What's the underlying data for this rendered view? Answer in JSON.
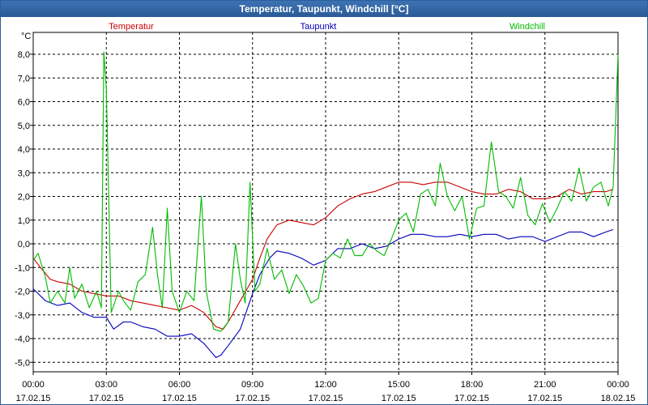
{
  "window": {
    "title": "Temperatur, Taupunkt, Windchill [°C]"
  },
  "colors": {
    "background": "#ffffff",
    "grid": "#000000",
    "temperatur": "#cc0000",
    "taupunkt": "#0000bb",
    "windchill": "#00bb00"
  },
  "chart_data": {
    "type": "line",
    "title": "Temperatur, Taupunkt, Windchill [°C]",
    "ylabel": "°C",
    "xlabel": "",
    "ylim": [
      -5.5,
      8.5
    ],
    "xlim": [
      0,
      24
    ],
    "grid": true,
    "legend_position": "top",
    "y_ticks": [
      8.0,
      7.0,
      6.0,
      5.0,
      4.0,
      3.0,
      2.0,
      1.0,
      0.0,
      -1.0,
      -2.0,
      -3.0,
      -4.0,
      -5.0
    ],
    "y_tick_labels": [
      "8,0",
      "7,0",
      "6,0",
      "5,0",
      "4,0",
      "3,0",
      "2,0",
      "1,0",
      "0,0",
      "-1,0",
      "-2,0",
      "-3,0",
      "-4,0",
      "-5,0"
    ],
    "x_ticks": [
      0,
      3,
      6,
      9,
      12,
      15,
      18,
      21,
      24
    ],
    "x_tick_labels": [
      {
        "time": "00:00",
        "date": "17.02.15"
      },
      {
        "time": "03:00",
        "date": "17.02.15"
      },
      {
        "time": "06:00",
        "date": "17.02.15"
      },
      {
        "time": "09:00",
        "date": "17.02.15"
      },
      {
        "time": "12:00",
        "date": "17.02.15"
      },
      {
        "time": "15:00",
        "date": "17.02.15"
      },
      {
        "time": "18:00",
        "date": "17.02.15"
      },
      {
        "time": "21:00",
        "date": "17.02.15"
      },
      {
        "time": "00:00",
        "date": "18.02.15"
      }
    ],
    "series": [
      {
        "name": "Temperatur",
        "color": "#cc0000",
        "points": [
          [
            0,
            -0.6
          ],
          [
            0.3,
            -1.0
          ],
          [
            0.7,
            -1.5
          ],
          [
            1.0,
            -1.6
          ],
          [
            1.5,
            -1.7
          ],
          [
            2.0,
            -2.0
          ],
          [
            2.5,
            -2.1
          ],
          [
            3.0,
            -2.2
          ],
          [
            3.5,
            -2.2
          ],
          [
            4.0,
            -2.4
          ],
          [
            4.5,
            -2.5
          ],
          [
            5.0,
            -2.6
          ],
          [
            5.5,
            -2.7
          ],
          [
            6.0,
            -2.8
          ],
          [
            6.5,
            -2.6
          ],
          [
            7.0,
            -2.9
          ],
          [
            7.5,
            -3.5
          ],
          [
            7.8,
            -3.6
          ],
          [
            8.0,
            -3.3
          ],
          [
            8.5,
            -2.4
          ],
          [
            9.0,
            -1.5
          ],
          [
            9.3,
            -0.6
          ],
          [
            9.6,
            0.2
          ],
          [
            10.0,
            0.8
          ],
          [
            10.5,
            1.0
          ],
          [
            11.0,
            0.9
          ],
          [
            11.5,
            0.8
          ],
          [
            12.0,
            1.1
          ],
          [
            12.5,
            1.6
          ],
          [
            13.0,
            1.9
          ],
          [
            13.5,
            2.1
          ],
          [
            14.0,
            2.2
          ],
          [
            14.5,
            2.4
          ],
          [
            15.0,
            2.6
          ],
          [
            15.5,
            2.6
          ],
          [
            16.0,
            2.5
          ],
          [
            16.5,
            2.6
          ],
          [
            17.0,
            2.6
          ],
          [
            17.5,
            2.4
          ],
          [
            18.0,
            2.2
          ],
          [
            18.5,
            2.1
          ],
          [
            19.0,
            2.1
          ],
          [
            19.5,
            2.3
          ],
          [
            20.0,
            2.2
          ],
          [
            20.5,
            1.9
          ],
          [
            21.0,
            1.9
          ],
          [
            21.5,
            2.0
          ],
          [
            22.0,
            2.3
          ],
          [
            22.5,
            2.1
          ],
          [
            23.0,
            2.2
          ],
          [
            23.5,
            2.2
          ],
          [
            23.8,
            2.3
          ]
        ]
      },
      {
        "name": "Taupunkt",
        "color": "#0000bb",
        "points": [
          [
            0,
            -1.9
          ],
          [
            0.5,
            -2.4
          ],
          [
            1.0,
            -2.6
          ],
          [
            1.5,
            -2.5
          ],
          [
            2.0,
            -2.9
          ],
          [
            2.5,
            -3.1
          ],
          [
            3.0,
            -3.1
          ],
          [
            3.3,
            -3.6
          ],
          [
            3.7,
            -3.3
          ],
          [
            4.0,
            -3.3
          ],
          [
            4.5,
            -3.5
          ],
          [
            5.0,
            -3.6
          ],
          [
            5.5,
            -3.9
          ],
          [
            6.0,
            -3.9
          ],
          [
            6.5,
            -3.8
          ],
          [
            7.0,
            -4.2
          ],
          [
            7.5,
            -4.8
          ],
          [
            7.7,
            -4.7
          ],
          [
            8.0,
            -4.3
          ],
          [
            8.5,
            -3.6
          ],
          [
            9.0,
            -2.1
          ],
          [
            9.3,
            -1.3
          ],
          [
            9.7,
            -0.6
          ],
          [
            10.0,
            -0.3
          ],
          [
            10.5,
            -0.4
          ],
          [
            11.0,
            -0.6
          ],
          [
            11.5,
            -0.9
          ],
          [
            12.0,
            -0.7
          ],
          [
            12.5,
            -0.2
          ],
          [
            13.0,
            -0.2
          ],
          [
            13.5,
            0.0
          ],
          [
            14.0,
            -0.2
          ],
          [
            14.5,
            -0.1
          ],
          [
            15.0,
            0.2
          ],
          [
            15.5,
            0.4
          ],
          [
            16.0,
            0.4
          ],
          [
            16.5,
            0.3
          ],
          [
            17.0,
            0.3
          ],
          [
            17.5,
            0.4
          ],
          [
            18.0,
            0.3
          ],
          [
            18.5,
            0.4
          ],
          [
            19.0,
            0.4
          ],
          [
            19.5,
            0.2
          ],
          [
            20.0,
            0.3
          ],
          [
            20.5,
            0.3
          ],
          [
            21.0,
            0.1
          ],
          [
            21.5,
            0.3
          ],
          [
            22.0,
            0.5
          ],
          [
            22.5,
            0.5
          ],
          [
            23.0,
            0.3
          ],
          [
            23.5,
            0.5
          ],
          [
            23.8,
            0.6
          ]
        ]
      },
      {
        "name": "Windchill",
        "color": "#00bb00",
        "points": [
          [
            0,
            -0.7
          ],
          [
            0.2,
            -0.4
          ],
          [
            0.5,
            -1.4
          ],
          [
            0.7,
            -2.5
          ],
          [
            1.0,
            -2.0
          ],
          [
            1.3,
            -2.5
          ],
          [
            1.5,
            -1.0
          ],
          [
            1.7,
            -2.3
          ],
          [
            2.0,
            -1.7
          ],
          [
            2.3,
            -2.7
          ],
          [
            2.6,
            -2.0
          ],
          [
            2.8,
            -2.7
          ],
          [
            2.9,
            8.1
          ],
          [
            3.0,
            6.5
          ],
          [
            3.2,
            -2.9
          ],
          [
            3.5,
            -2.0
          ],
          [
            3.7,
            -2.4
          ],
          [
            4.0,
            -2.8
          ],
          [
            4.3,
            -1.6
          ],
          [
            4.6,
            -1.3
          ],
          [
            4.9,
            0.7
          ],
          [
            5.1,
            -1.3
          ],
          [
            5.3,
            -2.7
          ],
          [
            5.5,
            1.5
          ],
          [
            5.7,
            -2.0
          ],
          [
            6.0,
            -2.9
          ],
          [
            6.3,
            -2.0
          ],
          [
            6.6,
            -2.4
          ],
          [
            6.9,
            2.0
          ],
          [
            7.1,
            -2.0
          ],
          [
            7.4,
            -3.6
          ],
          [
            7.7,
            -3.7
          ],
          [
            8.0,
            -3.3
          ],
          [
            8.3,
            0.0
          ],
          [
            8.5,
            -1.5
          ],
          [
            8.7,
            -2.5
          ],
          [
            8.9,
            2.6
          ],
          [
            9.1,
            -2.0
          ],
          [
            9.3,
            -1.7
          ],
          [
            9.6,
            -0.2
          ],
          [
            9.9,
            -1.5
          ],
          [
            10.2,
            -1.1
          ],
          [
            10.5,
            -2.1
          ],
          [
            10.8,
            -1.3
          ],
          [
            11.1,
            -1.8
          ],
          [
            11.4,
            -2.5
          ],
          [
            11.7,
            -2.3
          ],
          [
            12.0,
            -0.7
          ],
          [
            12.3,
            -0.4
          ],
          [
            12.6,
            -0.6
          ],
          [
            12.9,
            0.2
          ],
          [
            13.2,
            -0.5
          ],
          [
            13.5,
            -0.5
          ],
          [
            13.8,
            0.0
          ],
          [
            14.1,
            -0.3
          ],
          [
            14.4,
            -0.5
          ],
          [
            14.7,
            0.2
          ],
          [
            15.0,
            1.0
          ],
          [
            15.3,
            1.3
          ],
          [
            15.6,
            0.5
          ],
          [
            15.9,
            2.1
          ],
          [
            16.2,
            2.3
          ],
          [
            16.5,
            1.6
          ],
          [
            16.7,
            3.4
          ],
          [
            17.0,
            2.0
          ],
          [
            17.3,
            1.4
          ],
          [
            17.6,
            2.0
          ],
          [
            17.9,
            0.2
          ],
          [
            18.2,
            1.5
          ],
          [
            18.5,
            1.6
          ],
          [
            18.8,
            4.3
          ],
          [
            19.1,
            2.2
          ],
          [
            19.4,
            2.0
          ],
          [
            19.7,
            1.5
          ],
          [
            20.0,
            2.8
          ],
          [
            20.3,
            1.2
          ],
          [
            20.6,
            0.8
          ],
          [
            20.9,
            1.7
          ],
          [
            21.2,
            0.9
          ],
          [
            21.5,
            1.5
          ],
          [
            21.8,
            2.2
          ],
          [
            22.1,
            1.8
          ],
          [
            22.4,
            3.2
          ],
          [
            22.7,
            1.8
          ],
          [
            23.0,
            2.4
          ],
          [
            23.3,
            2.6
          ],
          [
            23.6,
            1.6
          ],
          [
            23.8,
            2.4
          ],
          [
            24.0,
            8.0
          ]
        ]
      }
    ]
  }
}
